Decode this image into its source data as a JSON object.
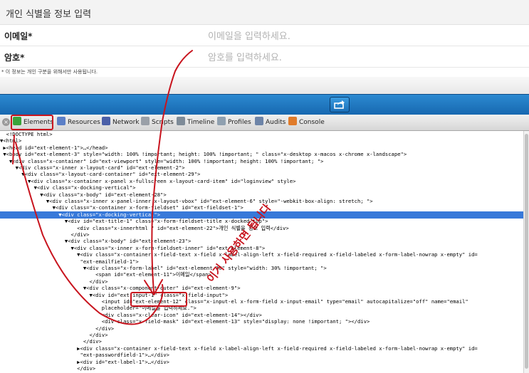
{
  "form": {
    "title": "개인 식별을 정보 입력",
    "email_label": "이메일*",
    "email_placeholder": "이메일을 입력하세요.",
    "password_label": "암호*",
    "password_placeholder": "암호를 입력하세요.",
    "note": "* 이 정보는 개인 구분을 위해서만 사용됩니다."
  },
  "devtools": {
    "close": "×",
    "tabs": [
      {
        "label": "Elements",
        "icon": "elements-icon",
        "color": "#3aa33a"
      },
      {
        "label": "Resources",
        "icon": "resources-icon",
        "color": "#5b7fc7"
      },
      {
        "label": "Network",
        "icon": "network-icon",
        "color": "#4a5fa8"
      },
      {
        "label": "Scripts",
        "icon": "scripts-icon",
        "color": "#9aa0a8"
      },
      {
        "label": "Timeline",
        "icon": "timeline-icon",
        "color": "#7e8b98"
      },
      {
        "label": "Profiles",
        "icon": "profiles-icon",
        "color": "#8fa0b0"
      },
      {
        "label": "Audits",
        "icon": "audits-icon",
        "color": "#6d84a8"
      },
      {
        "label": "Console",
        "icon": "console-icon",
        "color": "#e07b2a"
      }
    ]
  },
  "code_lines": [
    "  <!DOCTYPE html>",
    "▼<html>",
    " ▶<head id=\"ext-element-1\">…</head>",
    " ▼<body id=\"ext-element-3\" style=\"width: 100% !important; height: 100% !important; \" class=\"x-desktop x-macos x-chrome x-landscape\">",
    "   ▼<div class=\"x-container\" id=\"ext-viewport\" style=\"width: 100% !important; height: 100% !important; \">",
    "     ▼<div class=\"x-inner x-layout-card\" id=\"ext-element-2\">",
    "       ▼<div class=\"x-layout-card-container\" id=\"ext-element-29\">",
    "         ▼<div class=\"x-container x-panel x-fullscreen x-layout-card-item\" id=\"loginview\" style>",
    "           ▼<div class=\"x-docking-vertical\">",
    "             ▼<div class=\"x-body\" id=\"ext-element-28\">",
    "               ▼<div class=\"x-inner x-panel-inner x-layout-vbox\" id=\"ext-element-6\" style=\"-webkit-box-align: stretch; \">",
    "                 ▼<div class=\"x-container x-form-fieldset\" id=\"ext-fieldset-1\">",
    "                   ▼<div class=\"x-docking-vertical\">",
    "                     ▼<div id=\"ext-title-1\" class=\"x-form-fieldset-title x-docked-top\">",
    "                         <div class=\"x-innerhtml \" id=\"ext-element-22\">개인 식별을 정보 입력</div>",
    "                       </div>",
    "                     ▼<div class=\"x-body\" id=\"ext-element-23\">",
    "                       ▼<div class=\"x-inner x-form-fieldset-inner\" id=\"ext-element-8\">",
    "                         ▼<div class=\"x-container x-field-text x-field x-label-align-left x-field-required x-field-labeled x-form-label-nowrap x-empty\" id=",
    "                          \"ext-emailfield-1\">",
    "                           ▼<div class=\"x-form-label\" id=\"ext-element-10\" style=\"width: 30% !important; \">",
    "                               <span id=\"ext-element-11\">이메일</span>",
    "                             </div>",
    "                           ▼<div class=\"x-component-outer\" id=\"ext-element-9\">",
    "                             ▼<div id=\"ext-input-1\" class=\"x-field-input\">",
    "                                 <input id=\"ext-element-12\" class=\"x-input-el x-form-field x-input-email\" type=\"email\" autocapitalize=\"off\" name=\"email\"",
    "                                 placeholder=\"이메일을 입력하세요.\">",
    "                                 <div class=\"x-clear-icon\" id=\"ext-element-14\"></div>",
    "                                 <div class=\"x-field-mask\" id=\"ext-element-13\" style=\"display: none !important; \"></div>",
    "                               </div>",
    "                             </div>",
    "                           </div>",
    "                         ▶<div class=\"x-container x-field-text x-field x-label-align-left x-field-required x-field-labeled x-form-label-nowrap x-empty\" id=",
    "                          \"ext-passwordfield-1\">…</div>",
    "                         ▶<div id=\"ext-label-1\">…</div>",
    "                         </div>"
  ],
  "selected_line": 12,
  "annotation_text": "이거 사용하면 됩니다",
  "colors": {
    "toolbar_blue": "#1f78c1",
    "selection_blue": "#3879d9",
    "annotation_red": "#c8141e"
  }
}
